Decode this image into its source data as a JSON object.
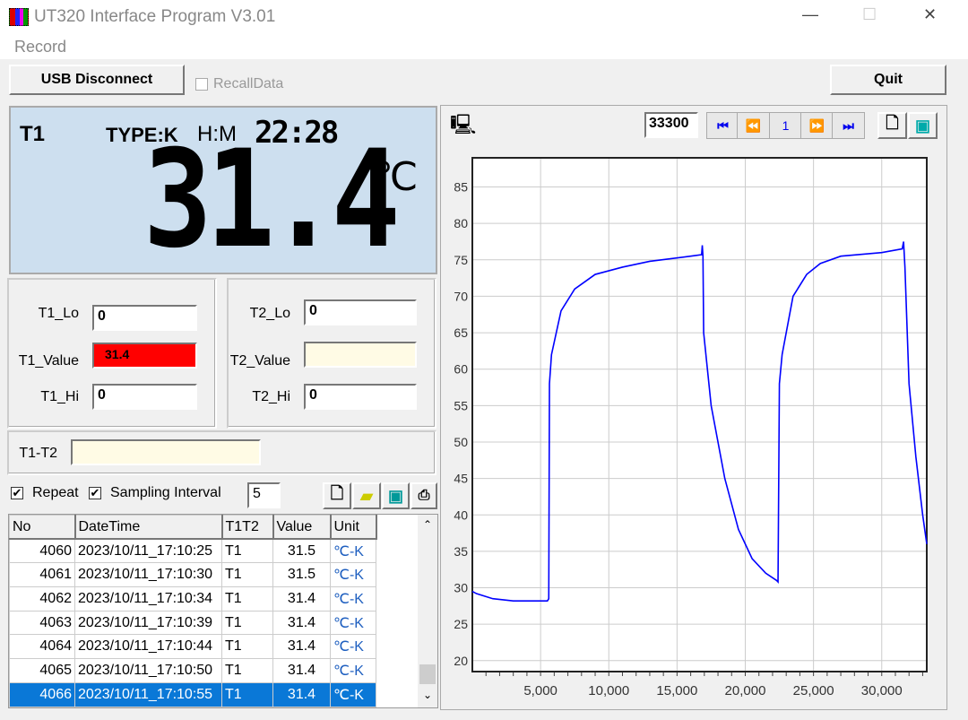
{
  "window": {
    "title": "UT320 Interface Program V3.01",
    "menu": [
      "Record"
    ]
  },
  "toolbar": {
    "usb_label": "USB Disconnect",
    "recall_label": "RecallData",
    "recall_checked": false,
    "quit_label": "Quit"
  },
  "lcd": {
    "channel": "T1",
    "type": "TYPE:K",
    "time_label": "H:M",
    "time": "22:28",
    "reading": "31.4",
    "unit": "℃"
  },
  "limits": {
    "t1_lo_label": "T1_Lo",
    "t1_lo": "0",
    "t1_value_label": "T1_Value",
    "t1_value": "31.4",
    "t1_value_color": "#ff0000",
    "t1_hi_label": "T1_Hi",
    "t1_hi": "0",
    "t2_lo_label": "T2_Lo",
    "t2_lo": "0",
    "t2_value_label": "T2_Value",
    "t2_value": "",
    "t2_hi_label": "T2_Hi",
    "t2_hi": "0",
    "diff_label": "T1-T2",
    "diff": ""
  },
  "sampling": {
    "repeat_label": "Repeat",
    "repeat_checked": true,
    "interval_label": "Sampling Interval",
    "interval_checked": true,
    "interval": "5"
  },
  "table": {
    "columns": [
      "No",
      "DateTime",
      "T1T2",
      "Value",
      "Unit"
    ],
    "rows": [
      [
        "4060",
        "2023/10/11_17:10:25",
        "T1",
        "31.5",
        "℃-K"
      ],
      [
        "4061",
        "2023/10/11_17:10:30",
        "T1",
        "31.5",
        "℃-K"
      ],
      [
        "4062",
        "2023/10/11_17:10:34",
        "T1",
        "31.4",
        "℃-K"
      ],
      [
        "4063",
        "2023/10/11_17:10:39",
        "T1",
        "31.4",
        "℃-K"
      ],
      [
        "4064",
        "2023/10/11_17:10:44",
        "T1",
        "31.4",
        "℃-K"
      ],
      [
        "4065",
        "2023/10/11_17:10:50",
        "T1",
        "31.4",
        "℃-K"
      ],
      [
        "4066",
        "2023/10/11_17:10:55",
        "T1",
        "31.4",
        "℃-K"
      ]
    ],
    "selected_row": 6
  },
  "chart_nav": {
    "points": "33300",
    "page": "1"
  },
  "chart_data": {
    "type": "line",
    "xlim": [
      0,
      33300
    ],
    "ylim": [
      18.5,
      89
    ],
    "grid": true,
    "x_ticks": [
      5000,
      10000,
      15000,
      20000,
      25000,
      30000
    ],
    "x_tick_labels": [
      "5,000",
      "10,000",
      "15,000",
      "20,000",
      "25,000",
      "30,000"
    ],
    "y_ticks": [
      20,
      25,
      30,
      35,
      40,
      45,
      50,
      55,
      60,
      65,
      70,
      75,
      80,
      85
    ],
    "series": [
      {
        "color": "#0000ff",
        "x": [
          0,
          300,
          1500,
          3000,
          5500,
          5600,
          5650,
          5800,
          6500,
          7500,
          9000,
          11000,
          13000,
          16000,
          16800,
          16850,
          16900,
          16950,
          17500,
          18500,
          19500,
          20500,
          21500,
          22300,
          22400,
          22500,
          22700,
          23500,
          24500,
          25500,
          27000,
          30000,
          31500,
          31600,
          31700,
          32000,
          32500,
          33000,
          33300
        ],
        "y": [
          29.5,
          29.2,
          28.5,
          28.2,
          28.2,
          28.5,
          58,
          62,
          68,
          71,
          73,
          74,
          74.8,
          75.5,
          75.7,
          77,
          75.5,
          65,
          55,
          45,
          38,
          34,
          32,
          31,
          30.8,
          58,
          62,
          70,
          73,
          74.5,
          75.5,
          76,
          76.5,
          77.5,
          74,
          58,
          48,
          40,
          36
        ]
      }
    ]
  }
}
